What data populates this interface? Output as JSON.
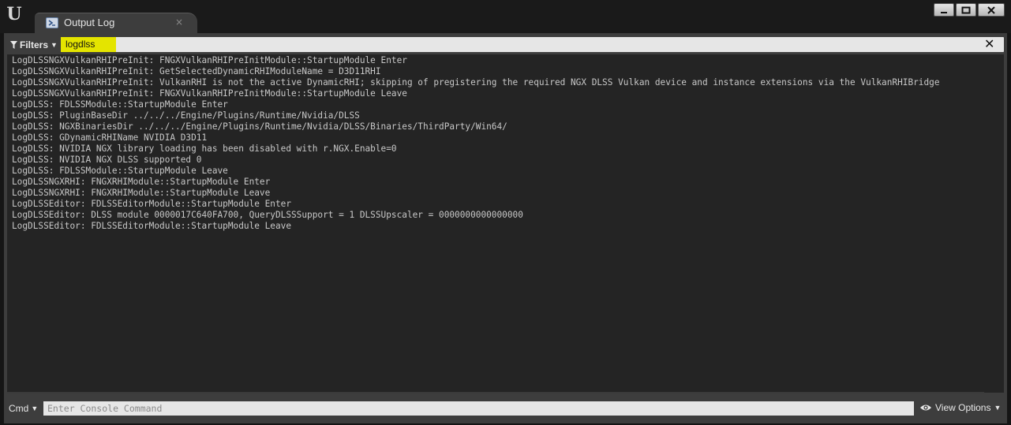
{
  "window": {
    "tab_label": "Output Log",
    "tab_close": "×",
    "buttons": {
      "minimize": "▁",
      "maximize": "▢",
      "close": "✕"
    }
  },
  "filter_bar": {
    "filters_label": "Filters",
    "search_value": "logdlss",
    "clear_label": "✕"
  },
  "log": {
    "highlight_prefix": "LogDLSS",
    "lines": [
      "NGXVulkanRHIPreInit: FNGXVulkanRHIPreInitModule::StartupModule Enter",
      "NGXVulkanRHIPreInit: GetSelectedDynamicRHIModuleName = D3D11RHI",
      "NGXVulkanRHIPreInit: VulkanRHI is not the active DynamicRHI; skipping of pregistering the required NGX DLSS Vulkan device and instance extensions via the VulkanRHIBridge",
      "NGXVulkanRHIPreInit: FNGXVulkanRHIPreInitModule::StartupModule Leave",
      ": FDLSSModule::StartupModule Enter",
      ": PluginBaseDir ../../../Engine/Plugins/Runtime/Nvidia/DLSS",
      ": NGXBinariesDir ../../../Engine/Plugins/Runtime/Nvidia/DLSS/Binaries/ThirdParty/Win64/",
      ": GDynamicRHIName NVIDIA D3D11",
      ": NVIDIA NGX library loading has been disabled with r.NGX.Enable=0",
      ": NVIDIA NGX DLSS supported 0",
      ": FDLSSModule::StartupModule Leave",
      "NGXRHI: FNGXRHIModule::StartupModule Enter",
      "NGXRHI: FNGXRHIModule::StartupModule Leave",
      "Editor: FDLSSEditorModule::StartupModule Enter",
      "Editor: DLSS module 0000017C640FA700, QueryDLSSSupport = 1 DLSSUpscaler = 0000000000000000",
      "Editor: FDLSSEditorModule::StartupModule Leave"
    ]
  },
  "cmd_bar": {
    "cmd_label": "Cmd",
    "placeholder": "Enter Console Command",
    "view_options_label": "View Options"
  },
  "icons": {
    "logo": "unreal-logo",
    "tab": "output-log-icon",
    "filter": "funnel-icon",
    "view": "eye-icon"
  }
}
